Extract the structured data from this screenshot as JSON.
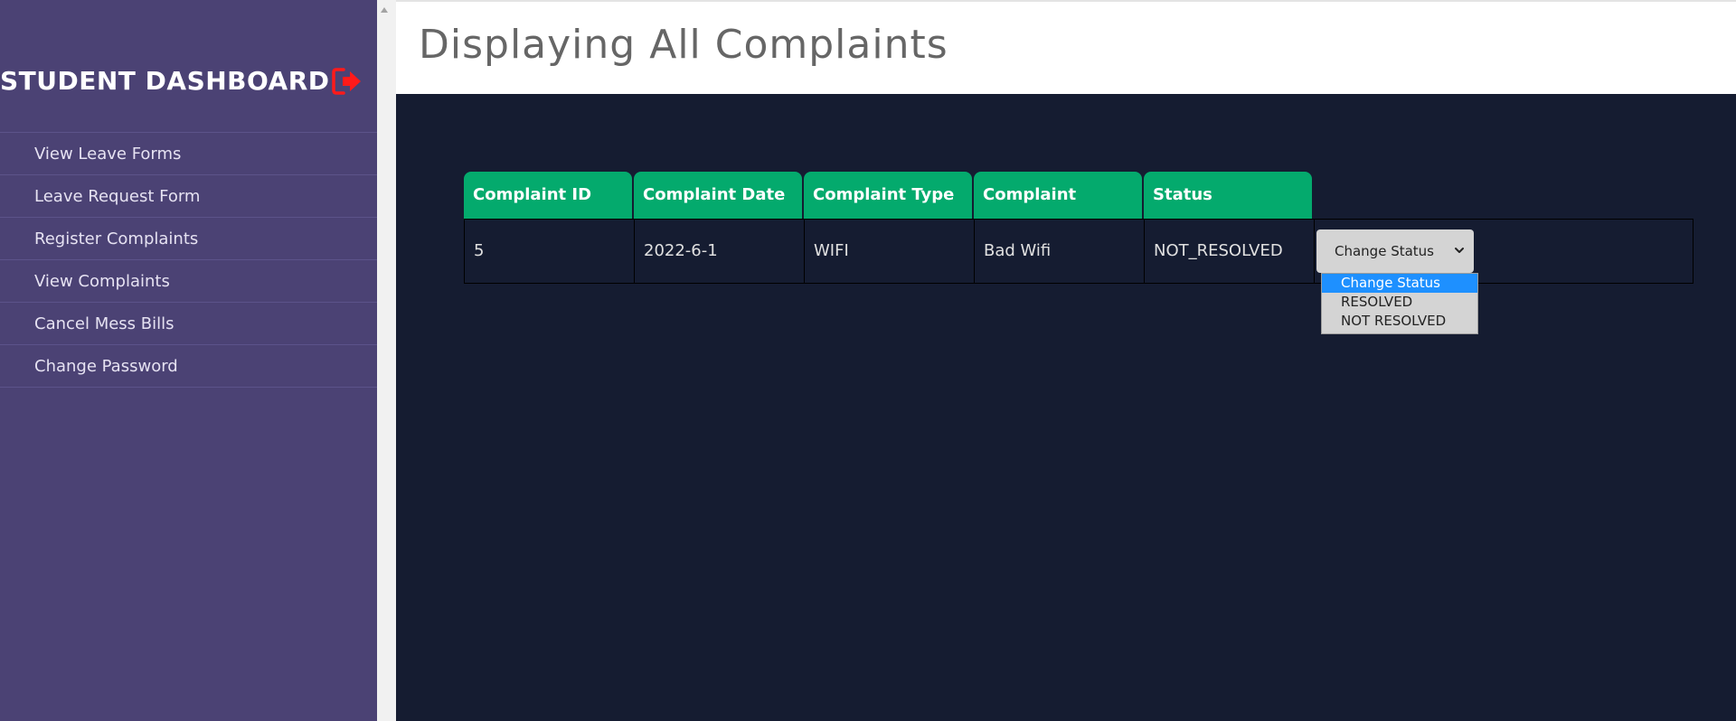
{
  "sidebar": {
    "brand_title": "STUDENT DASHBOARD",
    "logout_icon": "sign-out-icon",
    "items": [
      {
        "label": "View Leave Forms"
      },
      {
        "label": "Leave Request Form"
      },
      {
        "label": "Register Complaints"
      },
      {
        "label": "View Complaints"
      },
      {
        "label": "Cancel Mess Bills"
      },
      {
        "label": "Change Password"
      }
    ]
  },
  "header": {
    "title": "Displaying All Complaints"
  },
  "table": {
    "columns": [
      "Complaint ID",
      "Complaint Date",
      "Complaint Type",
      "Complaint",
      "Status"
    ],
    "rows": [
      {
        "id": "5",
        "date": "2022-6-1",
        "type": "WIFI",
        "complaint": "Bad Wifi",
        "status": "NOT_RESOLVED",
        "select_value": "Change Status"
      }
    ]
  },
  "dropdown": {
    "options": [
      "Change Status",
      "RESOLVED",
      "NOT RESOLVED"
    ],
    "highlighted": "Change Status"
  },
  "colors": {
    "sidebar_bg": "#4b4274",
    "content_bg": "#151c31",
    "header_cell_bg": "#04aa6d",
    "logout_icon": "#ff1a1a",
    "option_highlight": "#1e90ff"
  }
}
